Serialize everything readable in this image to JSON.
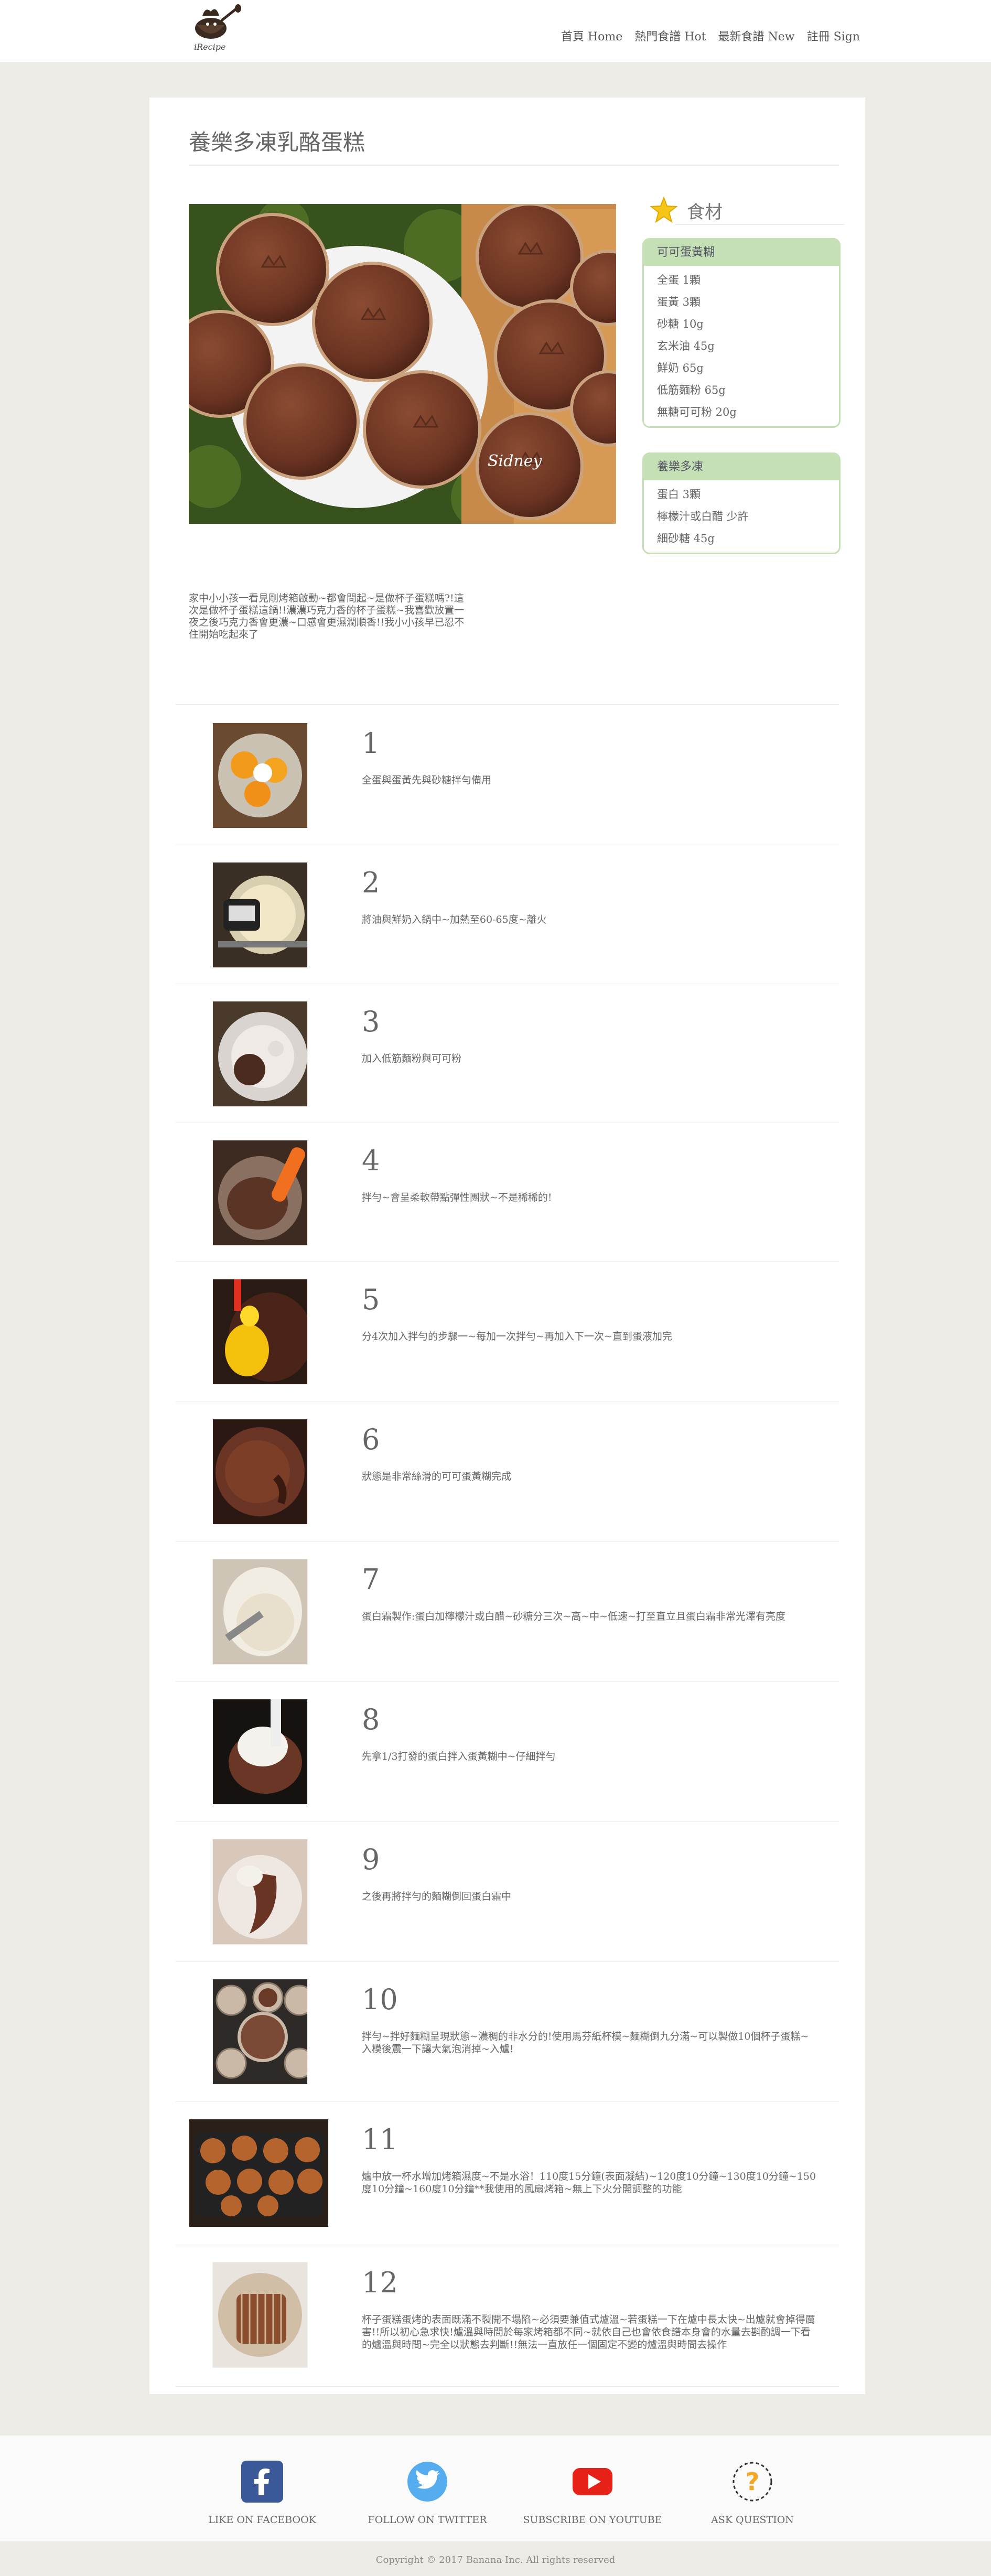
{
  "header": {
    "logo_text": "iRecipe",
    "nav": [
      {
        "label": "首頁 Home"
      },
      {
        "label": "熱門食譜 Hot"
      },
      {
        "label": "最新食譜 New"
      },
      {
        "label": "註冊 Sign"
      }
    ]
  },
  "recipe": {
    "title": "養樂多凍乳酪蛋糕",
    "intro": "家中小小孩一看見剛烤箱啟動~都會問起~是做杯子蛋糕嗎?!這次是做杯子蛋糕這鍋!!濃濃巧克力香的杯子蛋糕~我喜歡放置一夜之後巧克力香會更濃~口感會更濕潤順香!!我小小孩早已忍不住開始吃起來了",
    "hero_watermark": "Sidney"
  },
  "ingredients": {
    "heading": "食材",
    "groups": [
      {
        "name": "可可蛋黃糊",
        "items": [
          "全蛋 1顆",
          "蛋黃 3顆",
          "砂糖 10g",
          "玄米油 45g",
          "鮮奶 65g",
          "低筋麵粉 65g",
          "無糖可可粉 20g"
        ]
      },
      {
        "name": "養樂多凍",
        "items": [
          "蛋白 3顆",
          "檸檬汁或白醋 少許",
          "細砂糖 45g"
        ]
      }
    ]
  },
  "steps": [
    {
      "num": "1",
      "text": "全蛋與蛋黃先與砂糖拌勻備用"
    },
    {
      "num": "2",
      "text": "將油與鮮奶入鍋中~加熱至60-65度~離火"
    },
    {
      "num": "3",
      "text": "加入低筋麵粉與可可粉"
    },
    {
      "num": "4",
      "text": "拌勻~會呈柔軟帶點彈性團狀~不是稀稀的!"
    },
    {
      "num": "5",
      "text": "分4次加入拌勻的步驟一~每加一次拌勻~再加入下一次~直到蛋液加完"
    },
    {
      "num": "6",
      "text": "狀態是非常絲滑的可可蛋黃糊完成"
    },
    {
      "num": "7",
      "text": "蛋白霜製作:蛋白加檸檬汁或白醋~砂糖分三次~高~中~低速~打至直立且蛋白霜非常光澤有亮度"
    },
    {
      "num": "8",
      "text": "先拿1/3打發的蛋白拌入蛋黃糊中~仔細拌勻"
    },
    {
      "num": "9",
      "text": "之後再將拌勻的麵糊倒回蛋白霜中"
    },
    {
      "num": "10",
      "text": "拌勻~拌好麵糊呈現狀態~濃稠的非水分的!使用馬芬紙杯模~麵糊倒九分滿~可以製做10個杯子蛋糕~入模後震一下讓大氣泡消掉~入爐!"
    },
    {
      "num": "11",
      "text": "爐中放一杯水增加烤箱濕度~不是水浴！110度15分鐘(表面凝結)~120度10分鐘~130度10分鐘~150度10分鐘~160度10分鐘**我使用的風扇烤箱~無上下火分開調整的功能"
    },
    {
      "num": "12",
      "text": "杯子蛋糕蛋烤的表面既滿不裂開不塌陷~必須要兼值式爐溫~若蛋糕一下在爐中長太快~出爐就會掉得厲害!!所以初心急求快!爐溫與時間於每家烤箱都不同~就依自己也會依食譜本身會的水量去斟酌調一下看的爐溫與時間~完全以狀態去判斷!!無法一直放任一個固定不變的爐溫與時間去操作"
    }
  ],
  "footer": {
    "social": [
      {
        "label": "LIKE ON FACEBOOK",
        "icon": "facebook-icon",
        "color": "#3b5998"
      },
      {
        "label": "FOLLOW ON TWITTER",
        "icon": "twitter-icon",
        "color": "#55acee"
      },
      {
        "label": "SUBSCRIBE ON YOUTUBE",
        "icon": "youtube-icon",
        "color": "#e62117"
      },
      {
        "label": "ASK QUESTION",
        "icon": "question-icon",
        "color": "#f5a623"
      }
    ],
    "copyright": "Copyright © 2017 Banana Inc. All rights reserved"
  },
  "colors": {
    "accent_green": "#c5e0b4",
    "star_yellow": "#f5c518",
    "background": "#edebe6"
  }
}
